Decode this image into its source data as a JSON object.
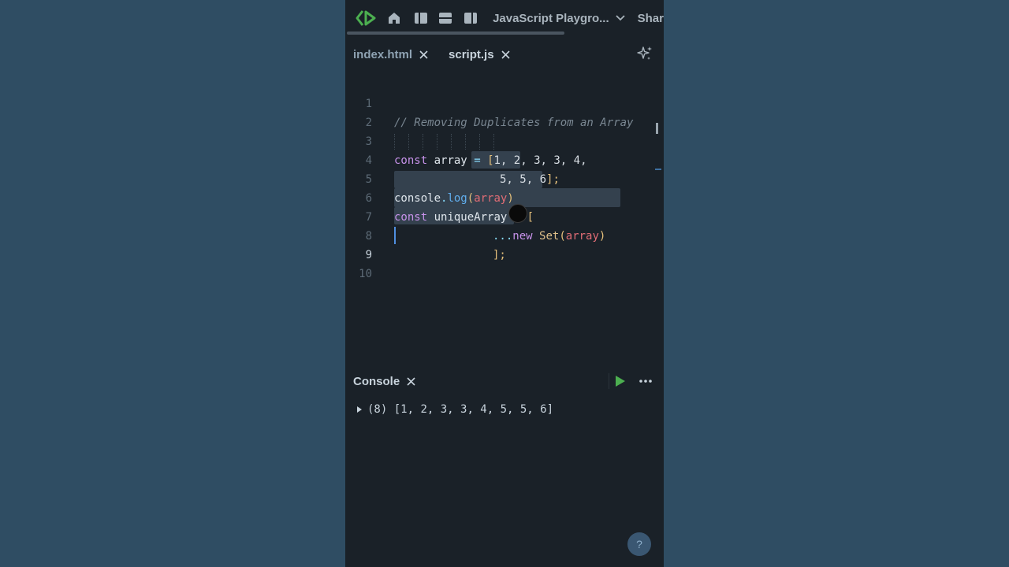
{
  "toolbar": {
    "title": "JavaScript Playgro...",
    "share_label": "Shar"
  },
  "tabs": [
    {
      "label": "index.html",
      "active": false
    },
    {
      "label": "script.js",
      "active": true
    }
  ],
  "editor": {
    "line_numbers": [
      "1",
      "2",
      "3",
      "4",
      "5",
      "6",
      "7",
      "8",
      "9",
      "10"
    ],
    "current_line": 9,
    "lines": {
      "l1": {
        "comment": "// Removing Duplicates from an Array"
      },
      "l3": {
        "kw": "const",
        "var": "array",
        "op": "=",
        "open": "[",
        "nums": "1, 2, 3, 3, 4,"
      },
      "l4": {
        "nums": "5, 5, 6",
        "close": "];"
      },
      "l5": {
        "obj": "console",
        "dot": ".",
        "fn": "log",
        "paren_open": "(",
        "arg": "array",
        "paren_close": ")"
      },
      "l6": {
        "kw": "const",
        "var": "uniqueArray",
        "op": "=",
        "open": "["
      },
      "l7": {
        "spread": "...",
        "kw": "new",
        "cls": "Set",
        "paren_open": "(",
        "arg": "array",
        "paren_close": ")"
      },
      "l8": {
        "close": "];"
      }
    }
  },
  "console": {
    "title": "Console",
    "output_count": "(8)",
    "output_value": "[1, 2, 3, 3, 4, 5, 5, 6]"
  },
  "help": {
    "label": "?"
  },
  "colors": {
    "background": "#2f4d63",
    "panel": "#1a2128",
    "accent_green": "#4caf50",
    "cursor": "#4f8fe0"
  },
  "icons": [
    "logo-icon",
    "home-icon",
    "layout-columns-icon",
    "layout-rows-icon",
    "layout-split-icon",
    "chevron-down-icon",
    "close-icon",
    "sparkle-icon",
    "play-icon",
    "more-icon",
    "expand-triangle-icon"
  ]
}
